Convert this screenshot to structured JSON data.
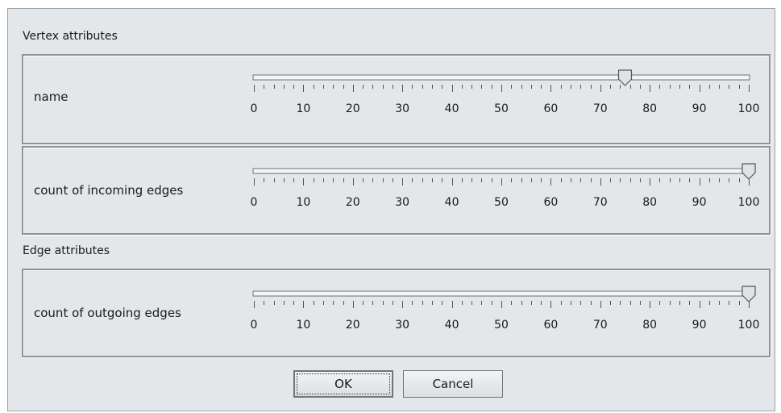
{
  "vertex_section": {
    "title": "Vertex attributes"
  },
  "edge_section": {
    "title": "Edge attributes"
  },
  "sliders": [
    {
      "label": "name",
      "value": 75
    },
    {
      "label": "count of incoming edges",
      "value": 100
    },
    {
      "label": "count of outgoing edges",
      "value": 100
    }
  ],
  "scale": {
    "min": 0,
    "max": 100,
    "major_step": 10,
    "minor_step": 2,
    "labels": [
      "0",
      "10",
      "20",
      "30",
      "40",
      "50",
      "60",
      "70",
      "80",
      "90",
      "100"
    ]
  },
  "buttons": {
    "ok_label": "OK",
    "cancel_label": "Cancel"
  }
}
